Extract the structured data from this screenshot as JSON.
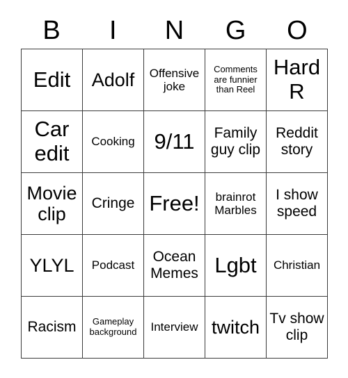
{
  "card": {
    "header_letters": [
      "B",
      "I",
      "N",
      "G",
      "O"
    ],
    "rows": [
      [
        {
          "label": "Edit",
          "size": "xl"
        },
        {
          "label": "Adolf",
          "size": "lg"
        },
        {
          "label": "Offensive joke",
          "size": "sm"
        },
        {
          "label": "Comments are funnier than Reel",
          "size": "xs"
        },
        {
          "label": "Hard R",
          "size": "xl"
        }
      ],
      [
        {
          "label": "Car edit",
          "size": "xl"
        },
        {
          "label": "Cooking",
          "size": "sm"
        },
        {
          "label": "9/11",
          "size": "xl"
        },
        {
          "label": "Family guy clip",
          "size": "md"
        },
        {
          "label": "Reddit story",
          "size": "md"
        }
      ],
      [
        {
          "label": "Movie clip",
          "size": "lg"
        },
        {
          "label": "Cringe",
          "size": "md"
        },
        {
          "label": "Free!",
          "size": "xl"
        },
        {
          "label": "brainrot Marbles",
          "size": "sm"
        },
        {
          "label": "I show speed",
          "size": "md"
        }
      ],
      [
        {
          "label": "YLYL",
          "size": "lg"
        },
        {
          "label": "Podcast",
          "size": "sm"
        },
        {
          "label": "Ocean Memes",
          "size": "md"
        },
        {
          "label": "Lgbt",
          "size": "xl"
        },
        {
          "label": "Christian",
          "size": "sm"
        }
      ],
      [
        {
          "label": "Racism",
          "size": "md"
        },
        {
          "label": "Gameplay background",
          "size": "xs"
        },
        {
          "label": "Interview",
          "size": "sm"
        },
        {
          "label": "twitch",
          "size": "lg"
        },
        {
          "label": "Tv show clip",
          "size": "md"
        }
      ]
    ]
  },
  "colors": {
    "grid_line": "#3a3a3a",
    "text": "#000000",
    "background": "#ffffff"
  }
}
